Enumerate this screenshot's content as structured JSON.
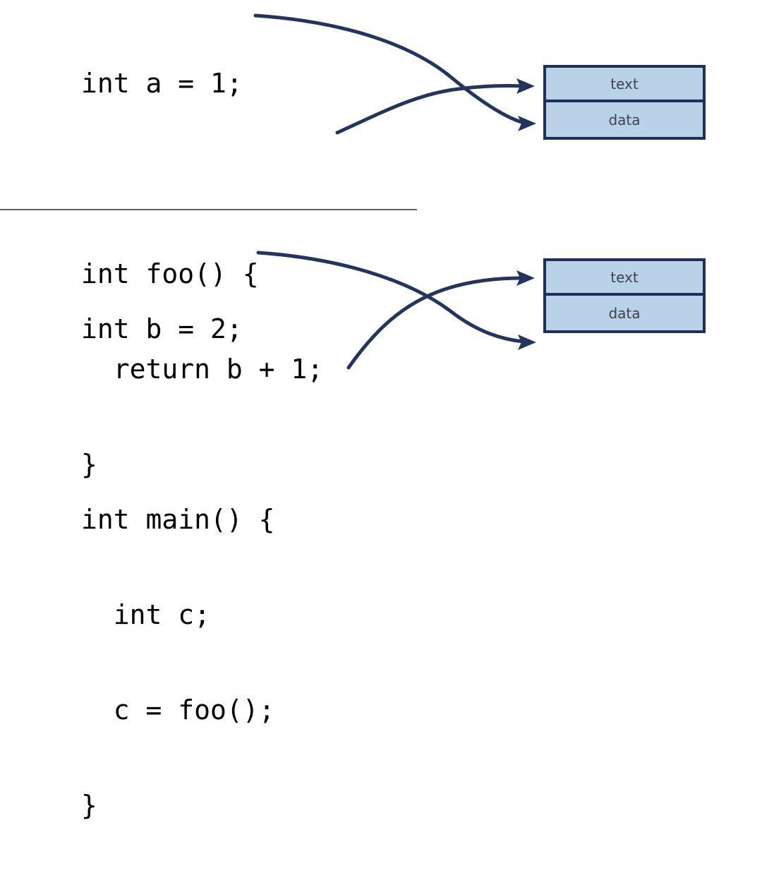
{
  "figure": {
    "background_color": "#ffffff",
    "accent_color": "#23355f",
    "box_fill_color": "#bad2e8",
    "box_border_color": "#1f3058",
    "divider_color": "#59616b",
    "code_color": "#000000",
    "segment_label_color": "#3b4252"
  },
  "units": [
    {
      "id": "unit-a",
      "code": {
        "lines": [
          "int a = 1;",
          "",
          "int foo() {",
          "  return b + 1;",
          "}"
        ]
      },
      "memory": {
        "segments": [
          {
            "label": "text"
          },
          {
            "label": "data"
          }
        ]
      },
      "arrows": [
        {
          "from": "int a = 1;",
          "to": "data"
        },
        {
          "from": "return b + 1;",
          "to": "text"
        }
      ]
    },
    {
      "id": "unit-b",
      "code": {
        "lines": [
          "int b = 2;",
          "",
          "int main() {",
          "  int c;",
          "  c = foo();",
          "}"
        ]
      },
      "memory": {
        "segments": [
          {
            "label": "text"
          },
          {
            "label": "data"
          }
        ]
      },
      "arrows": [
        {
          "from": "int b = 2;",
          "to": "data"
        },
        {
          "from": "c = foo();",
          "to": "text"
        }
      ]
    }
  ]
}
